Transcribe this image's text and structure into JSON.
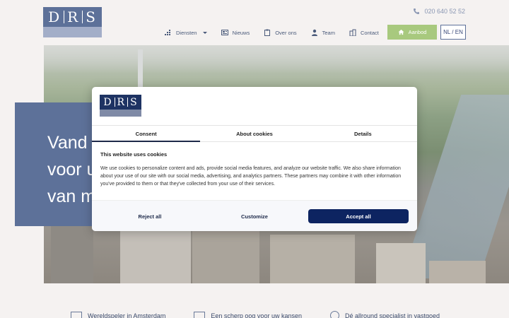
{
  "header": {
    "logo_text_left": "D",
    "logo_text_mid": "R",
    "logo_text_right": "S",
    "phone": "020 640 52 52",
    "nav": [
      {
        "label": "Diensten",
        "icon": "grid-dots-icon",
        "dropdown": true
      },
      {
        "label": "Nieuws",
        "icon": "newspaper-icon"
      },
      {
        "label": "Over ons",
        "icon": "clipboard-icon"
      },
      {
        "label": "Team",
        "icon": "person-icon"
      },
      {
        "label": "Contact",
        "icon": "building-icon"
      }
    ],
    "aanbod_label": "Aanbod",
    "lang_label": "NL / EN"
  },
  "hero": {
    "line1": "Vand",
    "line2": "voor u",
    "line3": "van m"
  },
  "features": [
    {
      "label": "Wereldspeler in Amsterdam"
    },
    {
      "label": "Een scherp oog voor uw kansen"
    },
    {
      "label": "Dé allround specialist in vastgoed"
    }
  ],
  "cookie": {
    "tabs": [
      "Consent",
      "About cookies",
      "Details"
    ],
    "active_tab": "Consent",
    "title": "This website uses cookies",
    "body": "We use cookies to personalize content and ads, provide social media features, and analyze our website traffic. We also share information about your use of our site with our social media, advertising, and analytics partners. These partners may combine it with other information you've provided to them or that they've collected from your use of their services.",
    "reject_label": "Reject all",
    "customize_label": "Customize",
    "accept_label": "Accept all"
  },
  "colors": {
    "brand_blue": "#5d7199",
    "dark_navy": "#0d2461",
    "accent_green": "#a8c97e"
  }
}
